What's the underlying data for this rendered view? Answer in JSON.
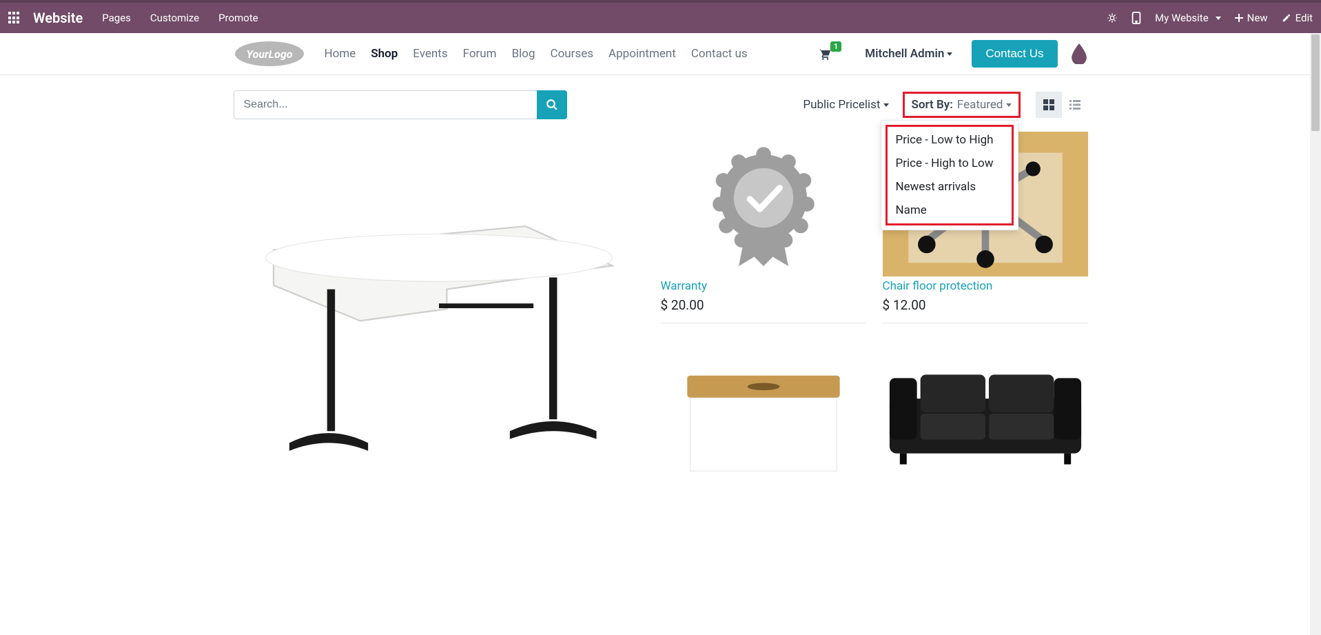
{
  "admin_bar": {
    "brand": "Website",
    "menus": [
      "Pages",
      "Customize",
      "Promote"
    ],
    "website_selector": "My Website",
    "new_label": "New",
    "edit_label": "Edit"
  },
  "header": {
    "nav": [
      {
        "label": "Home",
        "active": false
      },
      {
        "label": "Shop",
        "active": true
      },
      {
        "label": "Events",
        "active": false
      },
      {
        "label": "Forum",
        "active": false
      },
      {
        "label": "Blog",
        "active": false
      },
      {
        "label": "Courses",
        "active": false
      },
      {
        "label": "Appointment",
        "active": false
      },
      {
        "label": "Contact us",
        "active": false
      }
    ],
    "cart_count": "1",
    "user_name": "Mitchell Admin",
    "contact_button": "Contact Us"
  },
  "toolbar": {
    "search_placeholder": "Search...",
    "pricelist_label": "Public Pricelist",
    "sort_by_label": "Sort By:",
    "sort_by_value": "Featured",
    "sort_options": [
      "Price - Low to High",
      "Price - High to Low",
      "Newest arrivals",
      "Name"
    ]
  },
  "products": {
    "row1": [
      {
        "name": "Warranty",
        "price": "$ 20.00"
      },
      {
        "name": "Chair floor protection",
        "price": "$ 12.00"
      }
    ]
  }
}
